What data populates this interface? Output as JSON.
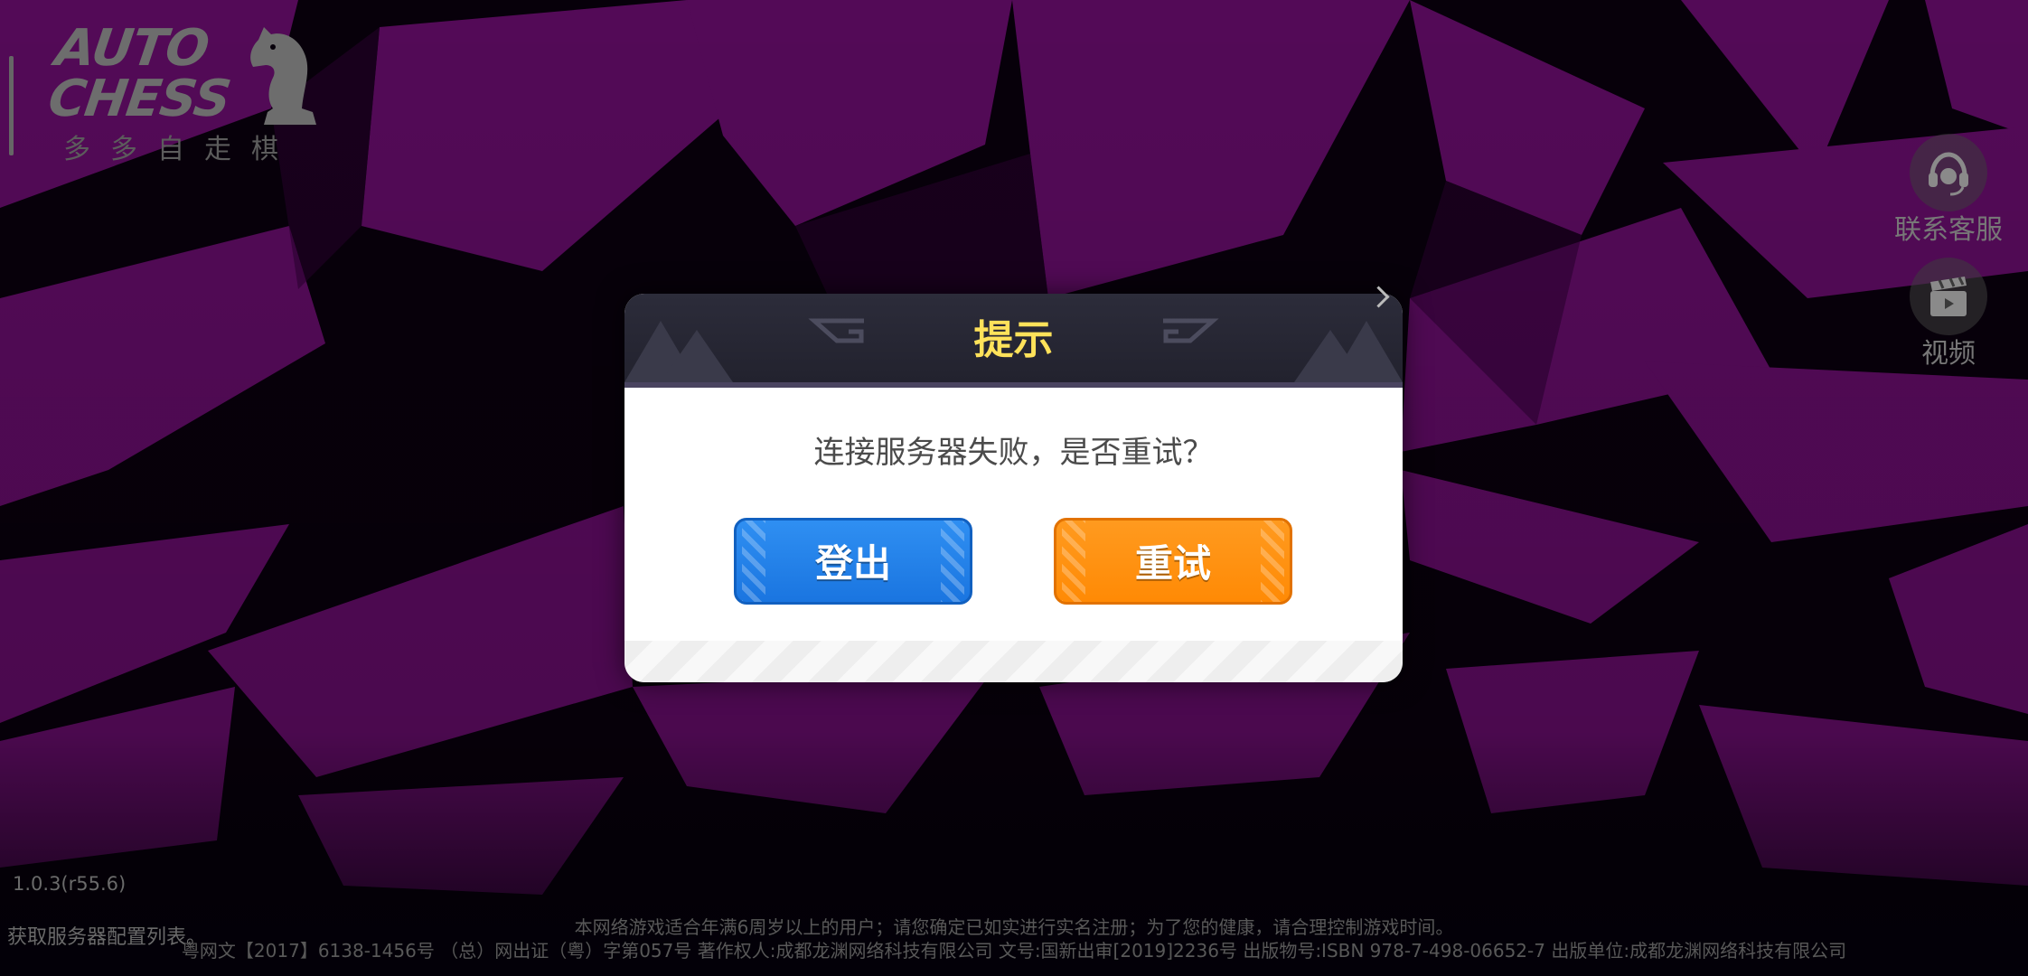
{
  "logo": {
    "main": "AUTO\nCHESS",
    "sub": "多多自走棋"
  },
  "side_buttons": {
    "customer_service": {
      "label": "联系客服",
      "icon": "headset-icon"
    },
    "video": {
      "label": "视频",
      "icon": "clapperboard-icon"
    }
  },
  "dialog": {
    "title": "提示",
    "message": "连接服务器失败，是否重试？",
    "logout_label": "登出",
    "retry_label": "重试"
  },
  "footer": {
    "version": "1.0.3(r55.6)",
    "status": "获取服务器配置列表。",
    "legal_line1": "本网络游戏适合年满6周岁以上的用户；请您确定已如实进行实名注册；为了您的健康，请合理控制游戏时间。",
    "legal_line2": "粤网文【2017】6138-1456号 （总）网出证（粤）字第057号 著作权人:成都龙渊网络科技有限公司 文号:国新出审[2019]2236号 出版物号:ISBN 978-7-498-06652-7 出版单位:成都龙渊网络科技有限公司"
  },
  "colors": {
    "background_purple": "#5a0a5e",
    "background_dark": "#07000a",
    "dialog_title": "#ffe25a",
    "logout_button": "#1f7fe8",
    "retry_button": "#ff900f"
  }
}
